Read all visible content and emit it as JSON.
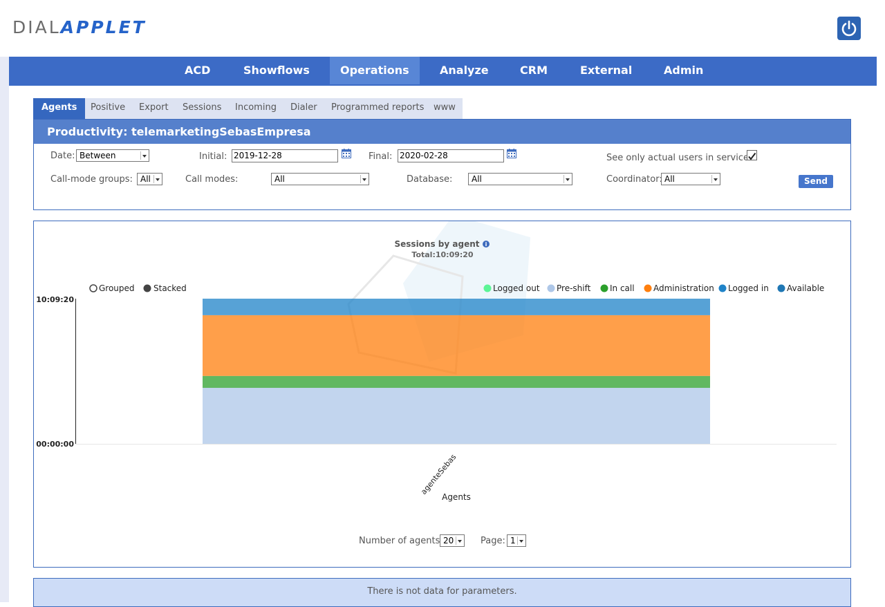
{
  "app": {
    "logo_part1": "DIAL",
    "logo_part2": "APPLET"
  },
  "nav": {
    "items": [
      {
        "label": "ACD"
      },
      {
        "label": "Showflows"
      },
      {
        "label": "Operations",
        "active": true
      },
      {
        "label": "Analyze"
      },
      {
        "label": "CRM"
      },
      {
        "label": "External"
      },
      {
        "label": "Admin"
      }
    ]
  },
  "tabs": [
    "Agents",
    "Positive",
    "Export",
    "Sessions",
    "Incoming",
    "Dialer",
    "Programmed reports",
    "www"
  ],
  "active_tab": "Agents",
  "panel": {
    "title": "Productivity: telemarketingSebasEmpresa"
  },
  "filters": {
    "date_label": "Date:",
    "date_value": "Between",
    "initial_label": "Initial:",
    "initial_value": "2019-12-28",
    "final_label": "Final:",
    "final_value": "2020-02-28",
    "see_only_label": "See only actual users in service:",
    "see_only_checked": true,
    "callmode_groups_label": "Call-mode groups:",
    "callmode_groups_value": "All",
    "callmodes_label": "Call modes:",
    "callmodes_value": "All",
    "database_label": "Database:",
    "database_value": "All",
    "coordinator_label": "Coordinator:",
    "coordinator_value": "All",
    "send_label": "Send"
  },
  "chart_controls": {
    "grouped_label": "Grouped",
    "stacked_label": "Stacked",
    "selected": "stacked"
  },
  "chart_data": {
    "type": "bar",
    "stacked": true,
    "title": "Sessions by agent",
    "subtitle": "Total:10:09:20",
    "xlabel": "Agents",
    "ylabel": "",
    "categories": [
      "agenteSebas"
    ],
    "y_ticks": [
      "00:00:00",
      "10:09:20"
    ],
    "ylim_seconds": [
      0,
      36560
    ],
    "legend_position": "top-right",
    "series": [
      {
        "name": "Logged out",
        "color": "#5cf596",
        "values": [
          0
        ]
      },
      {
        "name": "Pre-shift",
        "color": "#aec7e8",
        "values": [
          14100
        ]
      },
      {
        "name": "In call",
        "color": "#2ca02c",
        "values": [
          3000
        ]
      },
      {
        "name": "Administration",
        "color": "#ff7f0e",
        "values": [
          15300
        ]
      },
      {
        "name": "Logged in",
        "color": "#1f83c8",
        "values": [
          4160
        ]
      },
      {
        "name": "Available",
        "color": "#1f77b4",
        "values": [
          0
        ]
      }
    ]
  },
  "pagination": {
    "agents_label": "Number of agents:",
    "agents_value": "20",
    "page_label": "Page:",
    "page_value": "1"
  },
  "message": "There is not data for parameters."
}
